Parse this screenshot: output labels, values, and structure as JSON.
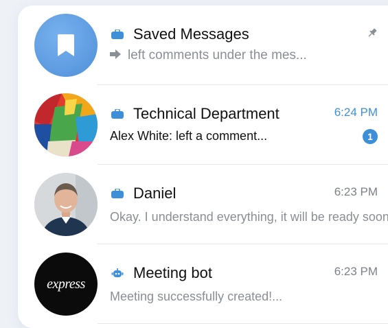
{
  "chats": [
    {
      "title": "Saved Messages",
      "time": "",
      "preview": "left comments under the mes...",
      "preview_prefix": "",
      "pinned": true,
      "unread": "",
      "icon": "briefcase-icon",
      "avatar": "bookmark-avatar"
    },
    {
      "title": "Technical Department",
      "time": "6:24 PM",
      "preview_sender": "Alex White",
      "preview": ": left a comment...",
      "unread": "1",
      "icon": "briefcase-icon",
      "avatar": "group-avatar-colorful"
    },
    {
      "title": "Daniel",
      "time": "6:23 PM",
      "preview": "Okay. I understand everything, it will be ready soon",
      "icon": "briefcase-icon",
      "avatar": "person-avatar"
    },
    {
      "title": "Meeting bot",
      "time": "6:23 PM",
      "preview": "Meeting successfully created!...",
      "icon": "bot-icon",
      "avatar": "express-avatar",
      "avatar_text": "express"
    }
  ],
  "colors": {
    "accent": "#3d8fd8",
    "saved_avatar": "#5b9be0",
    "muted_text": "#8a8f95"
  }
}
